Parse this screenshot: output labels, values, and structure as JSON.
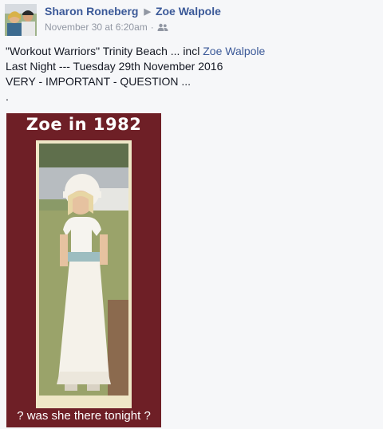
{
  "post": {
    "author": "Sharon Roneberg",
    "recipient": "Zoe Walpole",
    "timestamp": "November 30 at 6:20am",
    "audience_icon": "friends-icon",
    "lines": {
      "line1_prefix": "\"Workout Warriors\" Trinity Beach ... incl ",
      "line1_mention": "Zoe Walpole",
      "line2": "Last Night --- Tuesday 29th November 2016",
      "line3": "VERY - IMPORTANT - QUESTION ...",
      "line4": "."
    }
  },
  "photo": {
    "title": "Zoe in 1982",
    "caption": "? was she there tonight ?",
    "frame_color": "#6e1f26",
    "mat_color": "#efe7c7"
  },
  "colors": {
    "link": "#3b5998",
    "meta": "#9197a3",
    "background": "#f6f7f9"
  }
}
